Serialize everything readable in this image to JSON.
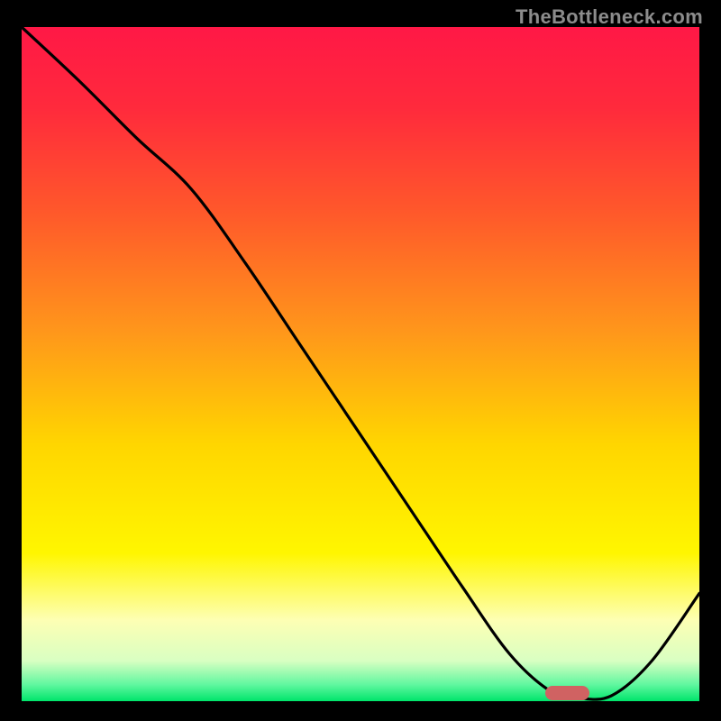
{
  "watermark": "TheBottleneck.com",
  "chart_data": {
    "type": "line",
    "title": "",
    "xlabel": "",
    "ylabel": "",
    "xlim": [
      0,
      100
    ],
    "ylim": [
      0,
      100
    ],
    "grid": false,
    "legend": false,
    "gradient_stops": [
      {
        "offset": 0.0,
        "color": "#ff1846"
      },
      {
        "offset": 0.12,
        "color": "#ff2a3c"
      },
      {
        "offset": 0.28,
        "color": "#ff5a2a"
      },
      {
        "offset": 0.45,
        "color": "#ff961b"
      },
      {
        "offset": 0.62,
        "color": "#ffd600"
      },
      {
        "offset": 0.78,
        "color": "#fff600"
      },
      {
        "offset": 0.88,
        "color": "#fdffb4"
      },
      {
        "offset": 0.94,
        "color": "#d9ffc2"
      },
      {
        "offset": 0.975,
        "color": "#62f7a0"
      },
      {
        "offset": 1.0,
        "color": "#00e56b"
      }
    ],
    "series": [
      {
        "name": "bottleneck-curve",
        "x": [
          0.0,
          8.5,
          17.0,
          25.0,
          33.0,
          41.0,
          49.0,
          57.0,
          65.0,
          72.0,
          78.0,
          82.0,
          87.0,
          93.0,
          100.0
        ],
        "y": [
          100.0,
          92.0,
          83.5,
          76.0,
          65.0,
          53.0,
          41.0,
          29.0,
          17.0,
          7.0,
          1.5,
          0.5,
          0.8,
          6.0,
          16.0
        ]
      }
    ],
    "marker": {
      "x": 80.5,
      "y": 1.2,
      "w": 6.5,
      "h": 2.2
    }
  }
}
